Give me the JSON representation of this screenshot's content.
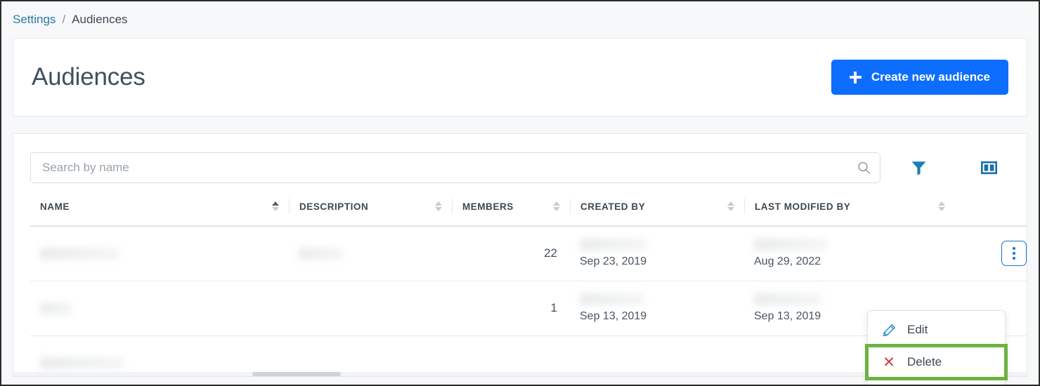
{
  "breadcrumb": {
    "parent": "Settings",
    "separator": "/",
    "current": "Audiences"
  },
  "header": {
    "title": "Audiences",
    "create_button_label": "Create new audience",
    "create_button_icon": "plus-icon",
    "create_button_color": "#0d6efd"
  },
  "toolbar": {
    "search_placeholder": "Search by name",
    "search_value": "",
    "search_icon": "search-icon",
    "filter_icon": "filter-funnel-icon",
    "columns_icon": "columns-layout-icon",
    "icon_color": "#1a7fb5"
  },
  "table": {
    "columns": [
      {
        "label": "NAME",
        "sortable": true,
        "sort": "asc"
      },
      {
        "label": "DESCRIPTION",
        "sortable": true,
        "sort": "none"
      },
      {
        "label": "MEMBERS",
        "sortable": true,
        "sort": "none"
      },
      {
        "label": "CREATED BY",
        "sortable": true,
        "sort": "none"
      },
      {
        "label": "LAST MODIFIED BY",
        "sortable": true,
        "sort": "none"
      }
    ],
    "rows": [
      {
        "name": "",
        "description": "",
        "members": "22",
        "created_by": "",
        "created_date": "Sep 23, 2019",
        "modified_by": "",
        "modified_date": "Aug 29, 2022",
        "row_menu_icon": "kebab-menu-icon"
      },
      {
        "name": "",
        "description": "",
        "members": "1",
        "created_by": "",
        "created_date": "Sep 13, 2019",
        "modified_by": "",
        "modified_date": "Sep 13, 2019",
        "row_menu_icon": "kebab-menu-icon"
      }
    ]
  },
  "row_menu": {
    "items": [
      {
        "label": "Edit",
        "icon": "pencil-edit-icon",
        "icon_color": "#2b8fd0",
        "highlighted": false
      },
      {
        "label": "Delete",
        "icon": "x-close-icon",
        "icon_color": "#d23b3b",
        "highlighted": true
      }
    ],
    "highlight_color": "#6cb33f"
  }
}
